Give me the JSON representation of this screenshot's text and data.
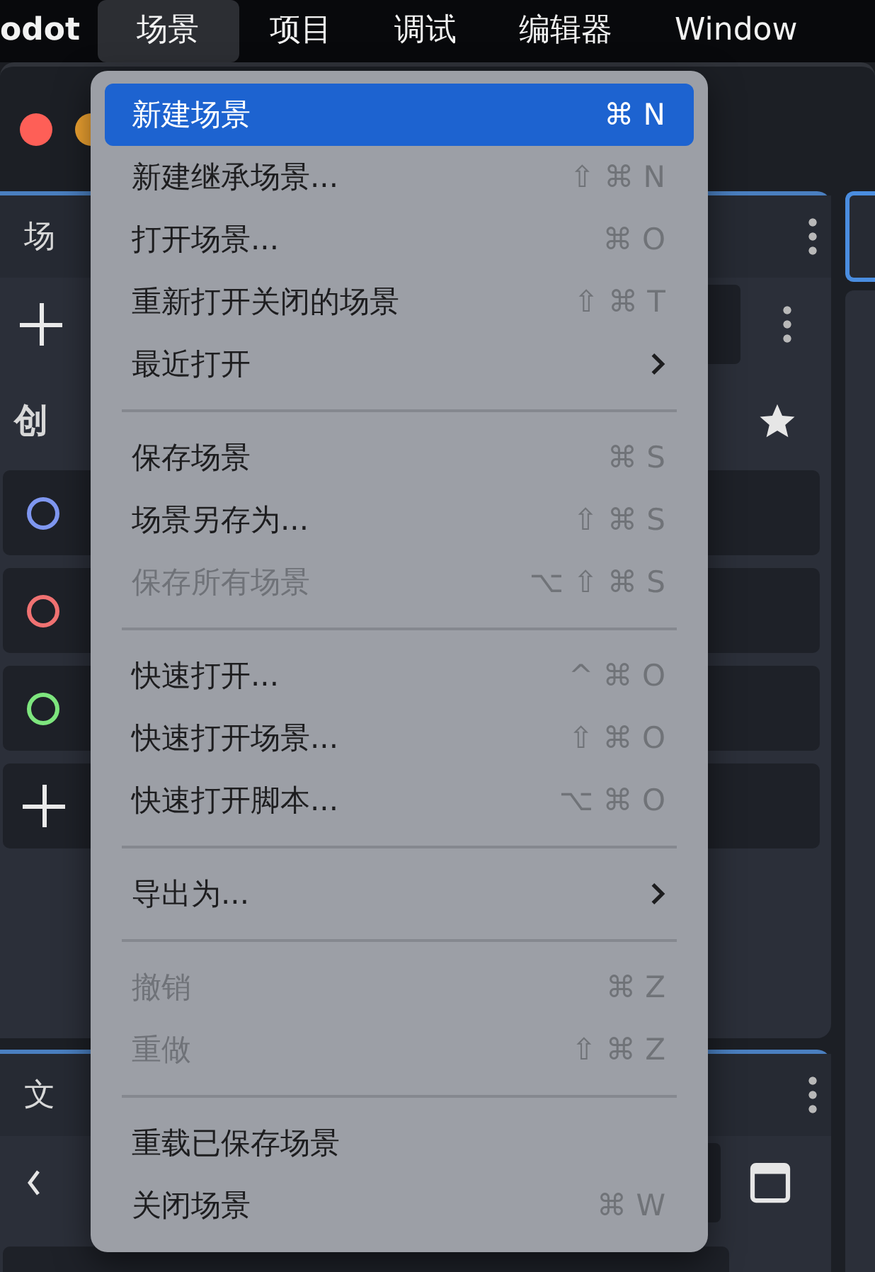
{
  "menu_bar": {
    "items": [
      {
        "label": "odot",
        "selected": false
      },
      {
        "label": "场景",
        "selected": true
      },
      {
        "label": "项目",
        "selected": false
      },
      {
        "label": "调试",
        "selected": false
      },
      {
        "label": "编辑器",
        "selected": false
      },
      {
        "label": "Window",
        "selected": false
      }
    ]
  },
  "background_window": {
    "scene_dock_tab": "场",
    "create_heading": "创",
    "node_rows": [
      {
        "kind": "circle",
        "color": "#7f97f0"
      },
      {
        "kind": "circle",
        "color": "#f07272"
      },
      {
        "kind": "circle",
        "color": "#7ee67e"
      },
      {
        "kind": "plus"
      }
    ],
    "filesystem_tab": "文"
  },
  "menu": {
    "items": [
      {
        "kind": "item",
        "label": "新建场景",
        "shortcut": "⌘ N",
        "selected": true,
        "disabled": false
      },
      {
        "kind": "item",
        "label": "新建继承场景...",
        "shortcut": "⇧ ⌘ N",
        "selected": false,
        "disabled": false
      },
      {
        "kind": "item",
        "label": "打开场景...",
        "shortcut": "⌘ O",
        "selected": false,
        "disabled": false
      },
      {
        "kind": "item",
        "label": "重新打开关闭的场景",
        "shortcut": "⇧ ⌘ T",
        "selected": false,
        "disabled": false
      },
      {
        "kind": "submenu",
        "label": "最近打开",
        "selected": false,
        "disabled": false
      },
      {
        "kind": "separator"
      },
      {
        "kind": "item",
        "label": "保存场景",
        "shortcut": "⌘ S",
        "selected": false,
        "disabled": false
      },
      {
        "kind": "item",
        "label": "场景另存为...",
        "shortcut": "⇧ ⌘ S",
        "selected": false,
        "disabled": false
      },
      {
        "kind": "item",
        "label": "保存所有场景",
        "shortcut": "⌥ ⇧ ⌘ S",
        "selected": false,
        "disabled": true
      },
      {
        "kind": "separator"
      },
      {
        "kind": "item",
        "label": "快速打开...",
        "shortcut": "^ ⌘ O",
        "selected": false,
        "disabled": false
      },
      {
        "kind": "item",
        "label": "快速打开场景...",
        "shortcut": "⇧ ⌘ O",
        "selected": false,
        "disabled": false
      },
      {
        "kind": "item",
        "label": "快速打开脚本...",
        "shortcut": "⌥ ⌘ O",
        "selected": false,
        "disabled": false
      },
      {
        "kind": "separator"
      },
      {
        "kind": "submenu",
        "label": "导出为...",
        "selected": false,
        "disabled": false
      },
      {
        "kind": "separator"
      },
      {
        "kind": "item",
        "label": "撤销",
        "shortcut": "⌘ Z",
        "selected": false,
        "disabled": true
      },
      {
        "kind": "item",
        "label": "重做",
        "shortcut": "⇧ ⌘ Z",
        "selected": false,
        "disabled": true
      },
      {
        "kind": "separator"
      },
      {
        "kind": "item",
        "label": "重载已保存场景",
        "selected": false,
        "disabled": false
      },
      {
        "kind": "item",
        "label": "关闭场景",
        "shortcut": "⌘ W",
        "selected": false,
        "disabled": false
      }
    ]
  }
}
